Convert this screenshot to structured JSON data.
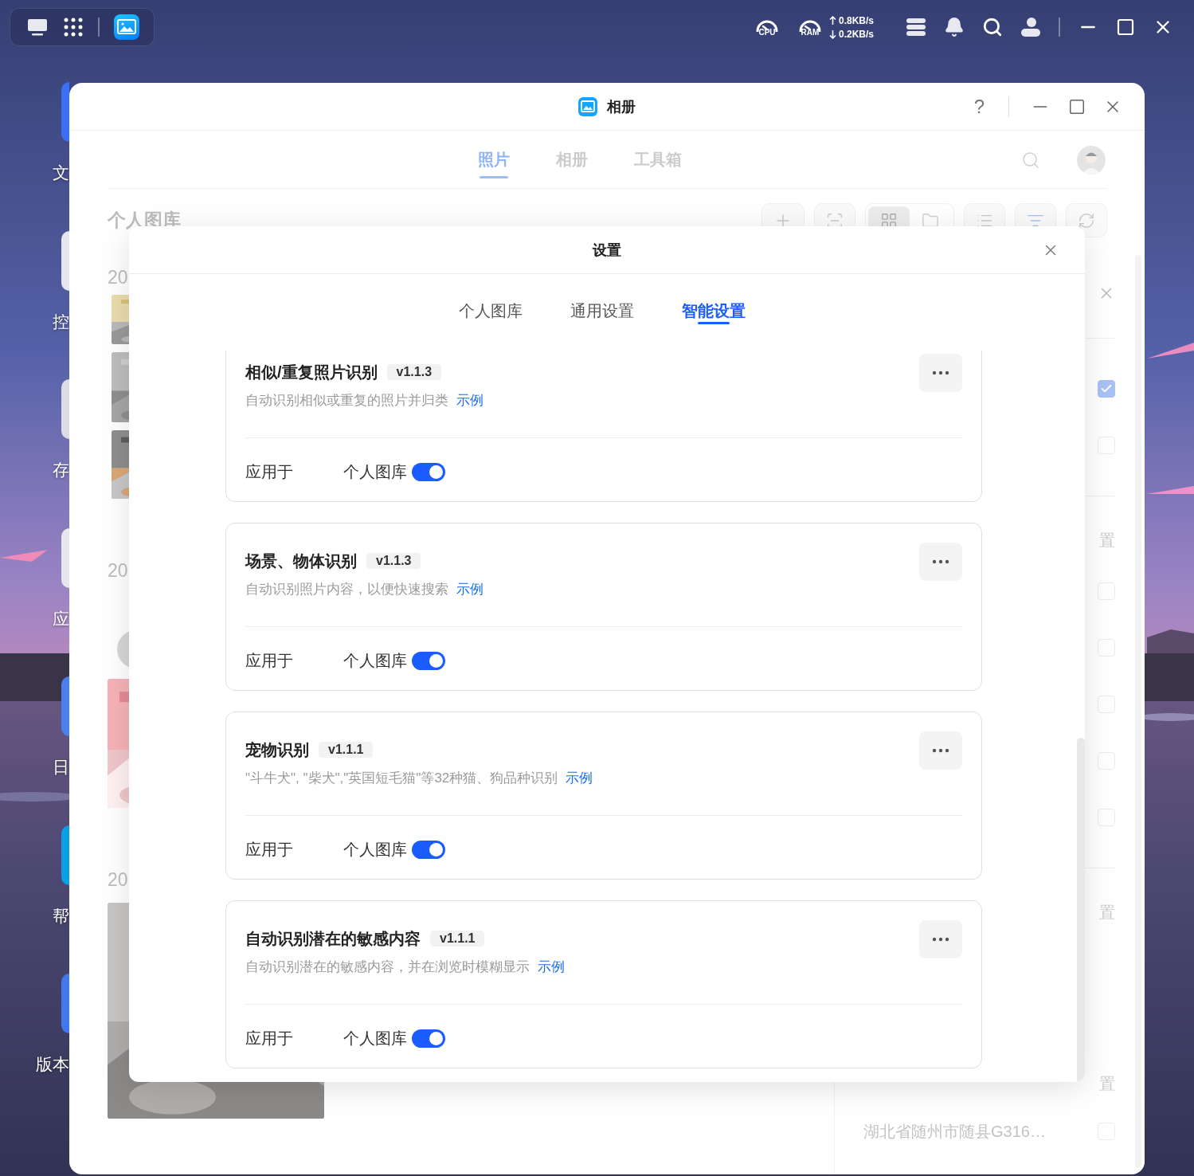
{
  "taskbar": {
    "cpu_label": "CPU",
    "ram_label": "RAM",
    "upload": "0.8KB/s",
    "download": "0.2KB/s"
  },
  "desktop_icons": [
    {
      "label": "文",
      "color": "#3b6ff5"
    },
    {
      "label": "控",
      "color": "#e6e6ee"
    },
    {
      "label": "存",
      "color": "#dcdce4"
    },
    {
      "label": "应",
      "color": "#e6e6ee"
    },
    {
      "label": "日",
      "color": "#4a7ff0"
    },
    {
      "label": "帮",
      "color": "#0aa0e8"
    },
    {
      "label": "版本",
      "color": "#3f78f0"
    }
  ],
  "app": {
    "title": "相册",
    "help": "?",
    "tabs": [
      {
        "label": "照片",
        "selected": true
      },
      {
        "label": "相册",
        "selected": false
      },
      {
        "label": "工具箱",
        "selected": false
      }
    ],
    "library_title": "个人图库",
    "view_modes": [
      {
        "selected": true
      },
      {
        "selected": false
      }
    ],
    "sections": [
      {
        "year": "20",
        "kind": "thumbs"
      },
      {
        "year": "20",
        "kind": "mixed"
      },
      {
        "year": "20"
      }
    ],
    "side_rows": [
      {
        "kind": "close"
      },
      {
        "kind": "divider"
      },
      {
        "kind": "check",
        "checked": true
      },
      {
        "kind": "check",
        "checked": false
      },
      {
        "kind": "divider"
      },
      {
        "kind": "reset",
        "label": "置"
      },
      {
        "kind": "check",
        "checked": false
      },
      {
        "kind": "check",
        "checked": false
      },
      {
        "kind": "check",
        "checked": false
      },
      {
        "kind": "check",
        "checked": false
      },
      {
        "kind": "check",
        "checked": false
      },
      {
        "kind": "divider"
      },
      {
        "kind": "reset",
        "label": "置"
      },
      {
        "kind": "section",
        "label": "置"
      },
      {
        "kind": "location",
        "text": "湖北省随州市随县G316…",
        "checked": false
      }
    ]
  },
  "settings": {
    "title": "设置",
    "tabs": [
      {
        "label": "个人图库",
        "selected": false
      },
      {
        "label": "通用设置",
        "selected": false
      },
      {
        "label": "智能设置",
        "selected": true
      }
    ],
    "features": [
      {
        "title": "相似/重复照片识别",
        "version": "v1.1.3",
        "description": "自动识别相似或重复的照片并归类",
        "link": "示例",
        "apply_label": "应用于",
        "scope": "个人图库",
        "on": true
      },
      {
        "title": "场景、物体识别",
        "version": "v1.1.3",
        "description": "自动识别照片内容，以便快速搜索",
        "link": "示例",
        "apply_label": "应用于",
        "scope": "个人图库",
        "on": true
      },
      {
        "title": "宠物识别",
        "version": "v1.1.1",
        "description": "\"斗牛犬\", \"柴犬\",\"英国短毛猫\"等32种猫、狗品种识别",
        "link": "示例",
        "apply_label": "应用于",
        "scope": "个人图库",
        "on": true
      },
      {
        "title": "自动识别潜在的敏感内容",
        "version": "v1.1.1",
        "description": "自动识别潜在的敏感内容，并在浏览时模糊显示",
        "link": "示例",
        "apply_label": "应用于",
        "scope": "个人图库",
        "on": true
      }
    ]
  }
}
